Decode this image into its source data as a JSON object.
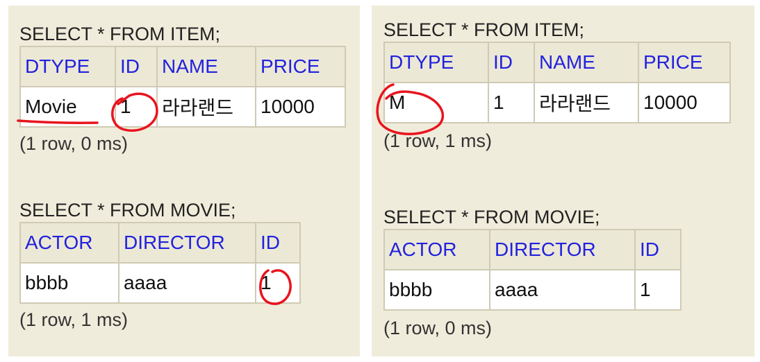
{
  "left": {
    "item_query": "SELECT * FROM ITEM;",
    "item_table": {
      "headers": [
        "DTYPE",
        "ID",
        "NAME",
        "PRICE"
      ],
      "row": [
        "Movie",
        "1",
        "라라랜드",
        "10000"
      ]
    },
    "item_info": "(1 row, 0 ms)",
    "movie_query": "SELECT * FROM MOVIE;",
    "movie_table": {
      "headers": [
        "ACTOR",
        "DIRECTOR",
        "ID"
      ],
      "row": [
        "bbbb",
        "aaaa",
        "1"
      ]
    },
    "movie_info": "(1 row, 1 ms)"
  },
  "right": {
    "item_query": "SELECT * FROM ITEM;",
    "item_table": {
      "headers": [
        "DTYPE",
        "ID",
        "NAME",
        "PRICE"
      ],
      "row": [
        "M",
        "1",
        "라라랜드",
        "10000"
      ]
    },
    "item_info": "(1 row, 1 ms)",
    "movie_query": "SELECT * FROM MOVIE;",
    "movie_table": {
      "headers": [
        "ACTOR",
        "DIRECTOR",
        "ID"
      ],
      "row": [
        "bbbb",
        "aaaa",
        "1"
      ]
    },
    "movie_info": "(1 row, 0 ms)"
  },
  "colors": {
    "panel_background": "#f0ecdb",
    "header_text": "#2222dd",
    "annotation_ink": "#e8141e"
  }
}
